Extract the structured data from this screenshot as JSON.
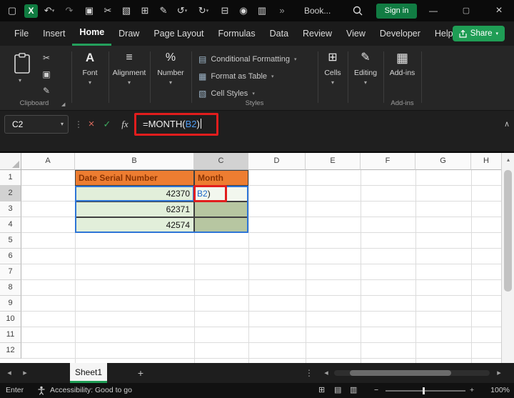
{
  "colors": {
    "excel_green": "#107C41",
    "share_green": "#1f9d55",
    "annotation_red": "#e11d1d",
    "header_fill_orange": "#ED7D31",
    "header_text_brown": "#8a3403",
    "cell_fill_green": "#E2EFDA",
    "cell_fill_green_selected": "#b7c6a1",
    "reference_blue": "#2e75d6"
  },
  "icons": {
    "chevron_down": "▾",
    "collapse_up": "∧",
    "check": "✓",
    "cancel": "×",
    "ellipsis_v": "⋮",
    "left_tri": "◂",
    "right_tri": "▸",
    "up_tri": "▴",
    "plus": "+",
    "minus": "−",
    "dialog_launcher": "◢"
  },
  "titlebar": {
    "window_icon_glyph": "▢",
    "excel_logo_letter": "X",
    "quick_icons": [
      {
        "name": "undo-icon",
        "glyph": "↶"
      },
      {
        "name": "redo-icon",
        "glyph": "↷"
      },
      {
        "name": "clipboard-icon",
        "glyph": "▣"
      },
      {
        "name": "cut-icon",
        "glyph": "✂"
      },
      {
        "name": "picture-icon",
        "glyph": "▧"
      },
      {
        "name": "table-icon",
        "glyph": "⊞"
      },
      {
        "name": "draw-icon",
        "glyph": "✎"
      },
      {
        "name": "rotate-left-icon",
        "glyph": "↺"
      },
      {
        "name": "rotate-right-icon",
        "glyph": "↻"
      },
      {
        "name": "print-icon",
        "glyph": "⊟"
      },
      {
        "name": "record-icon",
        "glyph": "◉"
      },
      {
        "name": "book-icon",
        "glyph": "▥"
      }
    ],
    "overflow_glyph": "»",
    "doc_name": "Book...",
    "sign_in_label": "Sign in",
    "minimize_glyph": "—",
    "maximize_glyph": "▢",
    "close_glyph": "×"
  },
  "menu": {
    "items": [
      "File",
      "Insert",
      "Home",
      "Draw",
      "Page Layout",
      "Formulas",
      "Data",
      "Review",
      "View",
      "Developer",
      "Help"
    ],
    "share_label": "Share"
  },
  "ribbon": {
    "clipboard": {
      "group_label": "Clipboard",
      "cut_glyph": "✂",
      "copy_glyph": "▣",
      "painter_glyph": "✎"
    },
    "font": {
      "label": "Font",
      "icon": "A"
    },
    "alignment": {
      "label": "Alignment",
      "icon": "≡"
    },
    "number": {
      "label": "Number",
      "icon": "%"
    },
    "styles": {
      "group_label": "Styles",
      "items": [
        {
          "label": "Conditional Formatting",
          "icon": "▤"
        },
        {
          "label": "Format as Table",
          "icon": "▦"
        },
        {
          "label": "Cell Styles",
          "icon": "▧"
        }
      ]
    },
    "cells": {
      "label": "Cells",
      "icon": "⊞"
    },
    "editing": {
      "label": "Editing",
      "icon": "✎"
    },
    "addins": {
      "label": "Add-ins",
      "icon": "▦",
      "group_label": "Add-ins"
    }
  },
  "formula_bar": {
    "name_box_value": "C2",
    "fx_label": "fx",
    "formula_prefix": "=MONTH(",
    "formula_ref": "B2",
    "formula_suffix": ")"
  },
  "grid": {
    "columns": [
      "A",
      "B",
      "C",
      "D",
      "E",
      "F",
      "G",
      "H"
    ],
    "rows": [
      "1",
      "2",
      "3",
      "4",
      "5",
      "6",
      "7",
      "8",
      "9",
      "10",
      "11",
      "12"
    ],
    "b1": "Date Serial Number",
    "c1": "Month",
    "b2": "42370",
    "b3": "62371",
    "b4": "42574",
    "c2_ref": "B2",
    "c2_suffix": ")"
  },
  "sheet_bar": {
    "tab_label": "Sheet1"
  },
  "status_bar": {
    "mode": "Enter",
    "accessibility_text": "Accessibility: Good to go",
    "view_icons": [
      {
        "name": "normal-view-icon",
        "glyph": "⊞"
      },
      {
        "name": "page-layout-view-icon",
        "glyph": "▤"
      },
      {
        "name": "page-break-view-icon",
        "glyph": "▥"
      }
    ],
    "zoom_label": "100%"
  }
}
